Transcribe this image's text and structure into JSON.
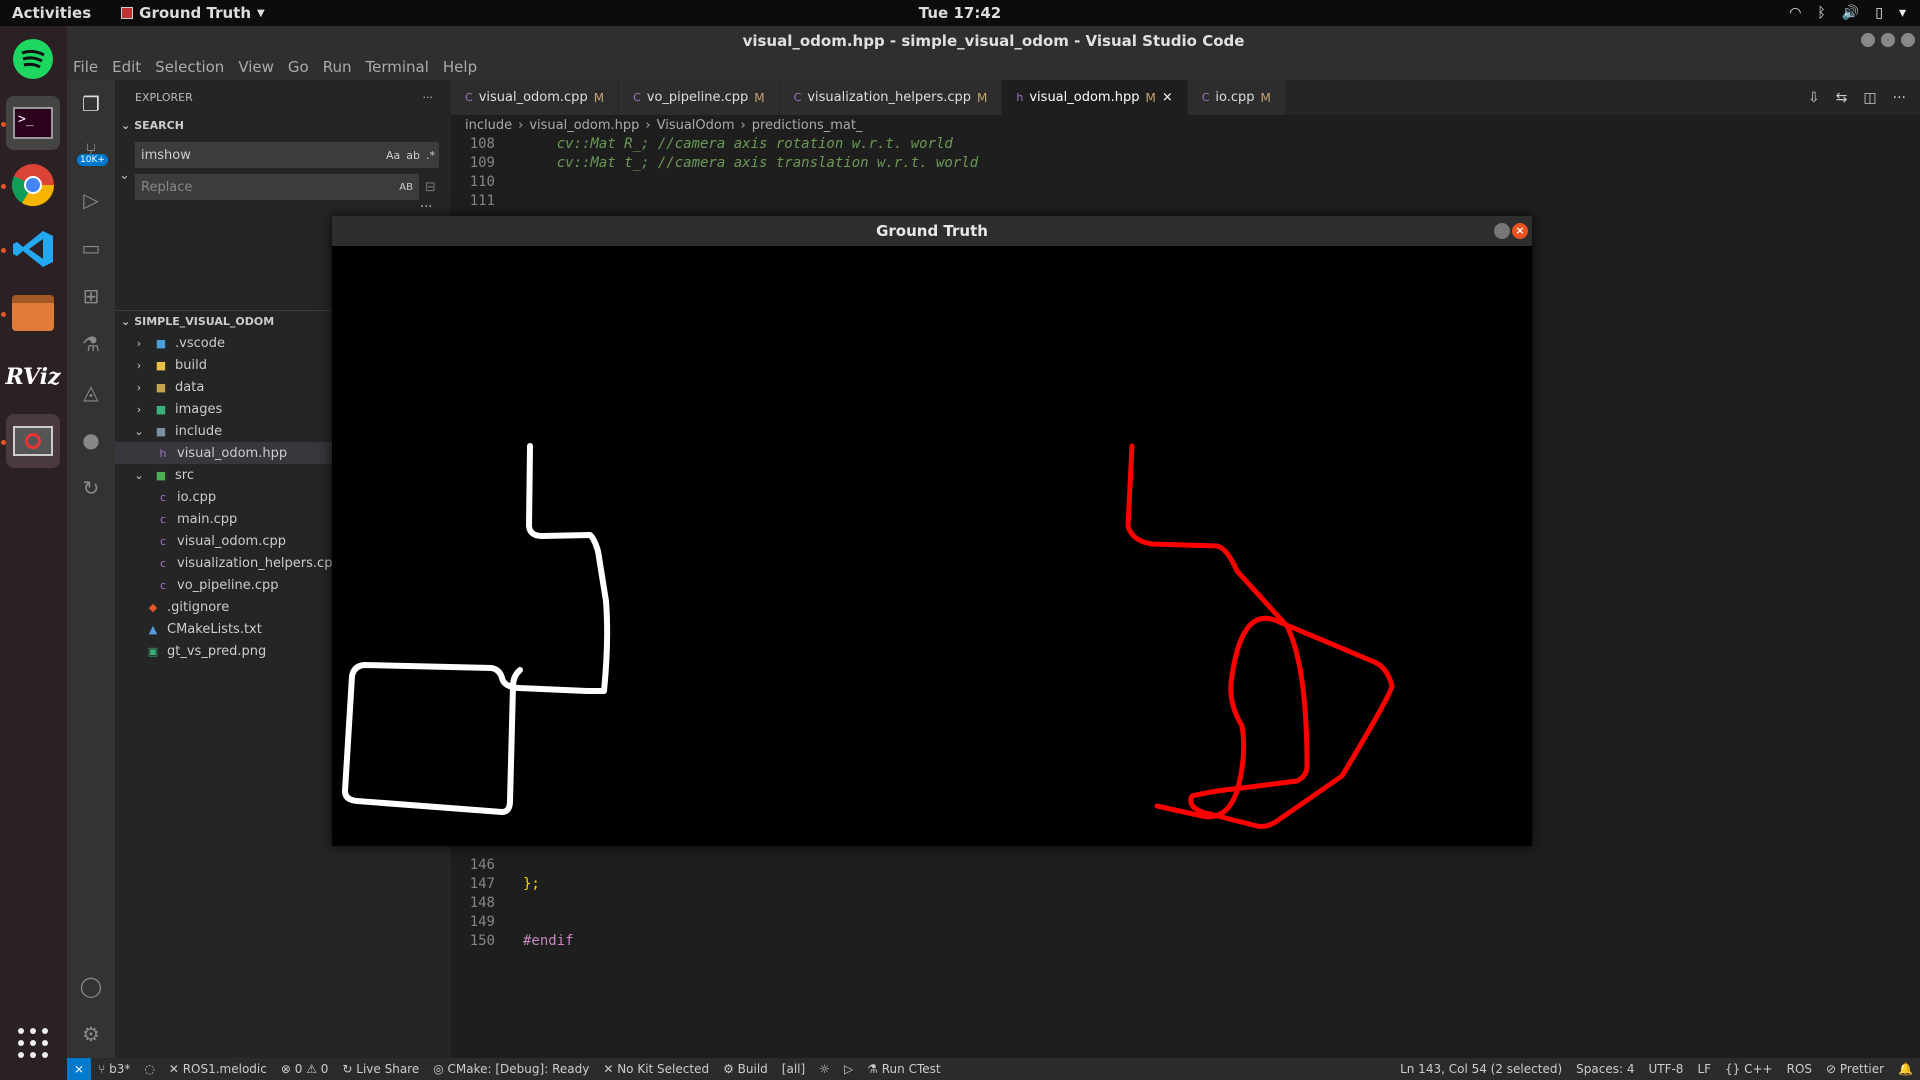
{
  "topbar": {
    "activities": "Activities",
    "app_menu": "Ground Truth",
    "clock": "Tue 17:42"
  },
  "window": {
    "title": "visual_odom.hpp - simple_visual_odom - Visual Studio Code",
    "menu": [
      "File",
      "Edit",
      "Selection",
      "View",
      "Go",
      "Run",
      "Terminal",
      "Help"
    ]
  },
  "activitybar": {
    "badge": "10K+"
  },
  "sidebar": {
    "header": "EXPLORER",
    "search_section": "SEARCH",
    "search_value": "imshow",
    "replace_placeholder": "Replace",
    "search_opts": [
      "Aa",
      "ab",
      ".*"
    ],
    "replace_opt": "AB",
    "project_section": "SIMPLE_VISUAL_ODOM",
    "tree": [
      {
        "label": ".vscode",
        "kind": "folder"
      },
      {
        "label": "build",
        "kind": "folder"
      },
      {
        "label": "data",
        "kind": "folder"
      },
      {
        "label": "images",
        "kind": "folder"
      },
      {
        "label": "include",
        "kind": "folder-open"
      },
      {
        "label": "visual_odom.hpp",
        "kind": "file-hpp"
      },
      {
        "label": "src",
        "kind": "folder-open"
      },
      {
        "label": "io.cpp",
        "kind": "file-cpp"
      },
      {
        "label": "main.cpp",
        "kind": "file-cpp"
      },
      {
        "label": "visual_odom.cpp",
        "kind": "file-cpp"
      },
      {
        "label": "visualization_helpers.cpp",
        "kind": "file-cpp"
      },
      {
        "label": "vo_pipeline.cpp",
        "kind": "file-cpp"
      },
      {
        "label": ".gitignore",
        "kind": "file-git"
      },
      {
        "label": "CMakeLists.txt",
        "kind": "file-cmake"
      },
      {
        "label": "gt_vs_pred.png",
        "kind": "file-image"
      }
    ]
  },
  "tabs": [
    {
      "label": "visual_odom.cpp",
      "status": "M"
    },
    {
      "label": "vo_pipeline.cpp",
      "status": "M"
    },
    {
      "label": "visualization_helpers.cpp",
      "status": "M"
    },
    {
      "label": "visual_odom.hpp",
      "status": "M"
    },
    {
      "label": "io.cpp",
      "status": "M"
    }
  ],
  "breadcrumbs": [
    "include",
    "visual_odom.hpp",
    "VisualOdom",
    "predictions_mat_"
  ],
  "code_top": [
    {
      "ln": "108",
      "text": "    cv::Mat R_; //camera axis rotation w.r.t. world"
    },
    {
      "ln": "109",
      "text": "    cv::Mat t_; //camera axis translation w.r.t. world"
    },
    {
      "ln": "110",
      "text": ""
    },
    {
      "ln": "111",
      "text": ""
    }
  ],
  "code_bottom": [
    {
      "ln": "146",
      "text": ""
    },
    {
      "ln": "147",
      "text": "};"
    },
    {
      "ln": "148",
      "text": ""
    },
    {
      "ln": "149",
      "text": ""
    },
    {
      "ln": "150",
      "text": "#endif"
    }
  ],
  "popup": {
    "title": "Ground Truth"
  },
  "statusbar": {
    "branch": "b3*",
    "ros": "ROS1.melodic",
    "problems": "0",
    "warnings": "0",
    "liveshare": "Live Share",
    "cmake": "CMake: [Debug]: Ready",
    "kit": "No Kit Selected",
    "build": "Build",
    "target": "[all]",
    "ctest": "Run CTest",
    "position": "Ln 143, Col 54 (2 selected)",
    "spaces": "Spaces: 4",
    "encoding": "UTF-8",
    "eol": "LF",
    "lang": "C++",
    "ros_ext": "ROS",
    "prettier": "Prettier"
  },
  "colors": {
    "accent": "#007acc",
    "gt_path": "#ffffff",
    "pred_path": "#ff0000"
  }
}
